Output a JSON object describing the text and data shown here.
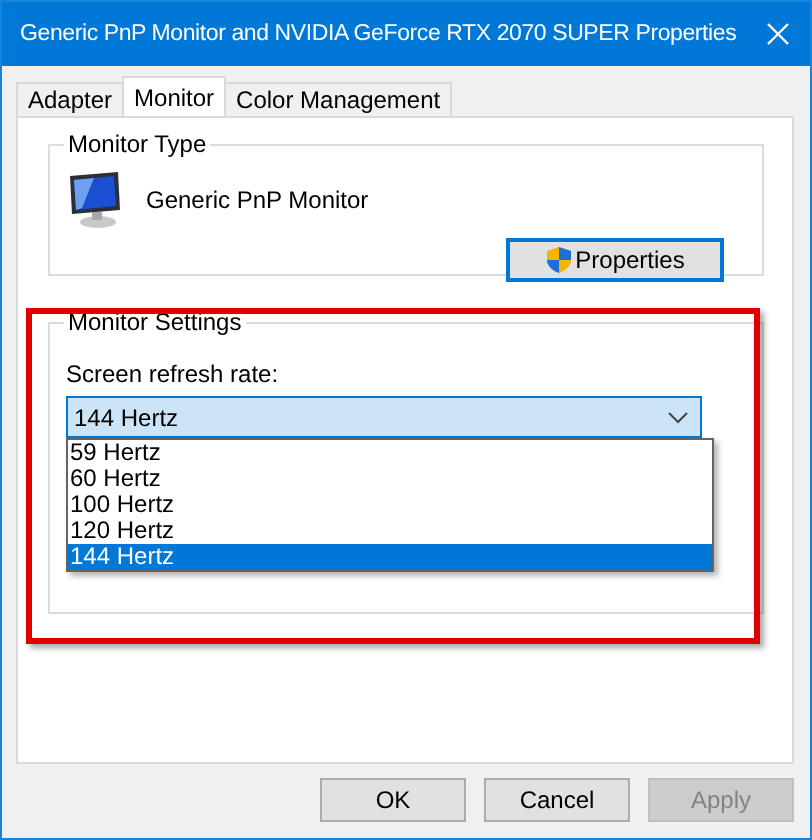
{
  "window": {
    "title": "Generic PnP Monitor and NVIDIA GeForce RTX 2070 SUPER Properties"
  },
  "tabs": [
    {
      "label": "Adapter",
      "selected": false
    },
    {
      "label": "Monitor",
      "selected": true
    },
    {
      "label": "Color Management",
      "selected": false
    }
  ],
  "monitor_type": {
    "title": "Monitor Type",
    "name": "Generic PnP Monitor",
    "properties_button": "Properties"
  },
  "monitor_settings": {
    "title": "Monitor Settings",
    "refresh_label": "Screen refresh rate:",
    "dropdown": {
      "value": "144 Hertz",
      "expanded": true,
      "options": [
        {
          "label": "59 Hertz",
          "selected": false
        },
        {
          "label": "60 Hertz",
          "selected": false
        },
        {
          "label": "100 Hertz",
          "selected": false
        },
        {
          "label": "120 Hertz",
          "selected": false
        },
        {
          "label": "144 Hertz",
          "selected": true
        }
      ]
    }
  },
  "buttons": [
    {
      "label": "OK",
      "disabled": false
    },
    {
      "label": "Cancel",
      "disabled": false
    },
    {
      "label": "Apply",
      "disabled": true
    }
  ]
}
